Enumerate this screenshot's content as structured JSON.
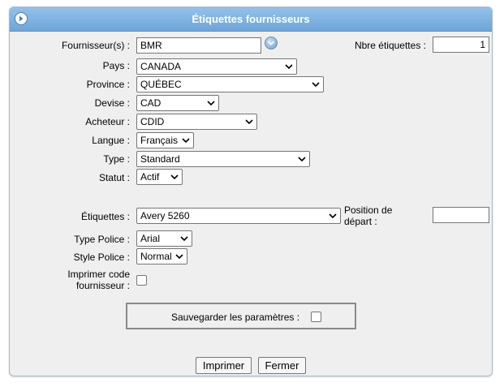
{
  "title": "Étiquettes fournisseurs",
  "form": {
    "fournisseur_label": "Fournisseur(s) :",
    "fournisseur_value": "BMR",
    "nbre_label": "Nbre étiquettes :",
    "nbre_value": "1",
    "pays_label": "Pays :",
    "pays_value": "CANADA",
    "province_label": "Province :",
    "province_value": "QUÉBEC",
    "devise_label": "Devise :",
    "devise_value": "CAD",
    "acheteur_label": "Acheteur :",
    "acheteur_value": "CDID",
    "langue_label": "Langue :",
    "langue_value": "Français",
    "type_label": "Type :",
    "type_value": "Standard",
    "statut_label": "Statut :",
    "statut_value": "Actif",
    "etiquettes_label": "Étiquettes :",
    "etiquettes_value": "Avery 5260",
    "position_label_1": "Position de",
    "position_label_2": "départ :",
    "position_value": "",
    "type_police_label": "Type Police :",
    "type_police_value": "Arial",
    "style_police_label": "Style Police :",
    "style_police_value": "Normal",
    "imprimer_code_label_1": "Imprimer code",
    "imprimer_code_label_2": "fournisseur :",
    "imprimer_code_checked": false,
    "sauvegarder_label": "Sauvegarder les paramètres :",
    "sauvegarder_checked": false
  },
  "buttons": {
    "imprimer": "Imprimer",
    "fermer": "Fermer"
  },
  "colors": {
    "titlebar": "#7aaee0",
    "panel_bg": "#efefef"
  },
  "icons": {
    "collapse": "circle-arrow-right-icon",
    "lookup": "chevron-down-circle-icon"
  }
}
